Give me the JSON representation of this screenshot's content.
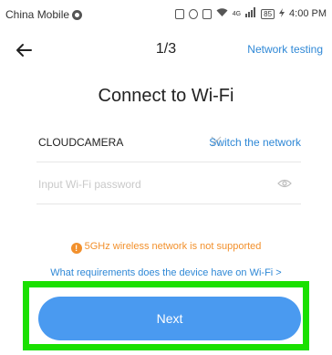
{
  "status_bar": {
    "carrier": "China Mobile",
    "network_type": "4G",
    "battery": "85",
    "time": "4:00 PM"
  },
  "header": {
    "step": "1/3",
    "network_testing": "Network testing"
  },
  "title": "Connect to Wi-Fi",
  "wifi": {
    "ssid": "CLOUDCAMERA",
    "switch_network": "Switch the network",
    "password_value": "",
    "password_placeholder": "Input Wi-Fi password"
  },
  "warning": {
    "text": "5GHz wireless network is not supported"
  },
  "requirements_link": "What requirements does the device have on Wi-Fi >",
  "next_button": "Next",
  "colors": {
    "accent": "#2f88d6",
    "button": "#4a9af0",
    "warning": "#f2902c",
    "highlight": "#19e000"
  }
}
